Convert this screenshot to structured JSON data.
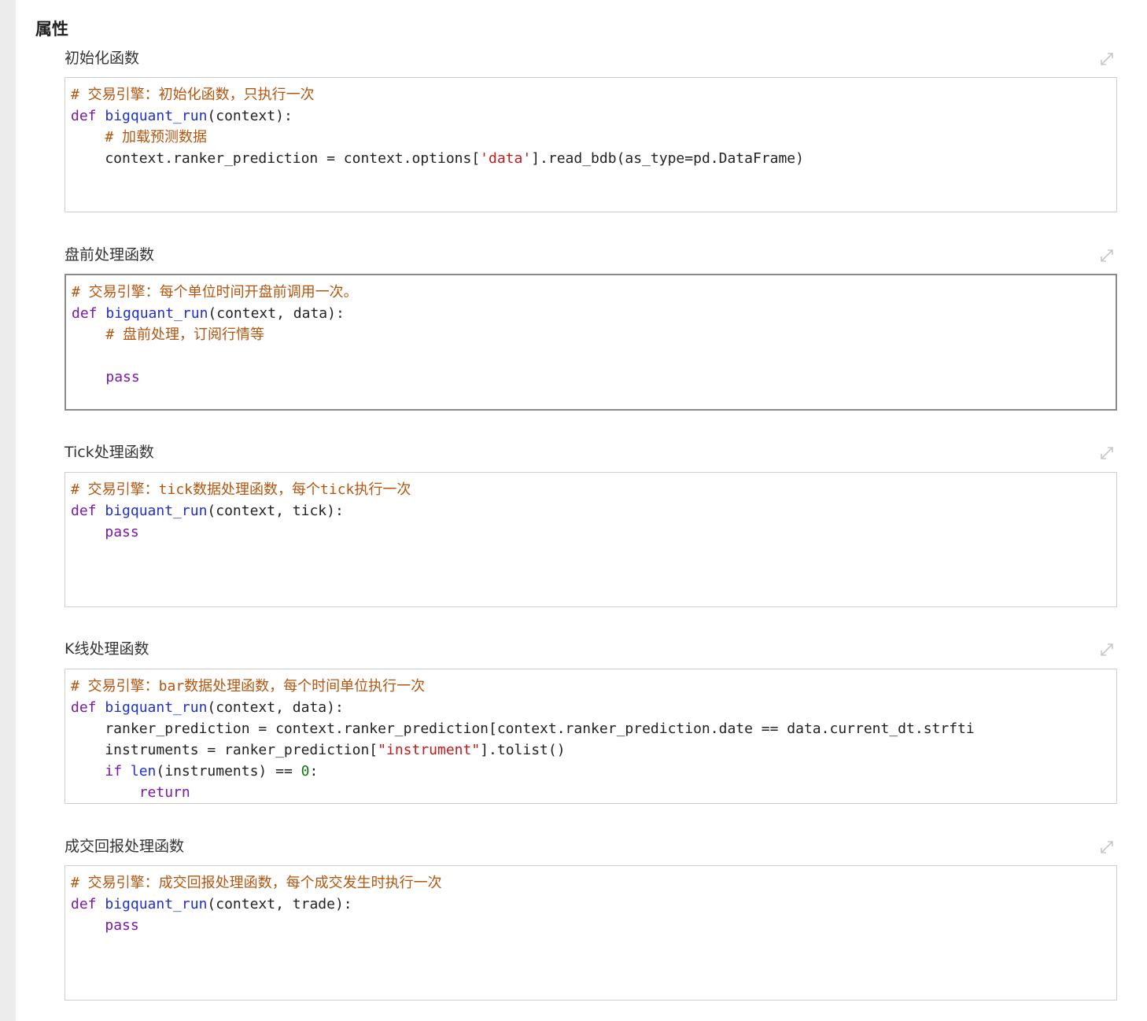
{
  "section_title": "属性",
  "properties": [
    {
      "label": "初始化函数",
      "lines": [
        [
          {
            "t": "cm",
            "s": "# 交易引擎：初始化函数，只执行一次"
          }
        ],
        [
          {
            "t": "kw",
            "s": "def "
          },
          {
            "t": "fn",
            "s": "bigquant_run"
          },
          {
            "t": "",
            "s": "(context):"
          }
        ],
        [
          {
            "t": "",
            "s": "    "
          },
          {
            "t": "cm",
            "s": "# 加载预测数据"
          }
        ],
        [
          {
            "t": "",
            "s": "    context.ranker_prediction = context.options["
          },
          {
            "t": "st",
            "s": "'data'"
          },
          {
            "t": "",
            "s": "].read_bdb(as_type=pd.DataFrame)"
          }
        ]
      ]
    },
    {
      "label": "盘前处理函数",
      "lines": [
        [
          {
            "t": "cm",
            "s": "# 交易引擎：每个单位时间开盘前调用一次。"
          }
        ],
        [
          {
            "t": "kw",
            "s": "def "
          },
          {
            "t": "fn",
            "s": "bigquant_run"
          },
          {
            "t": "",
            "s": "(context, data):"
          }
        ],
        [
          {
            "t": "",
            "s": "    "
          },
          {
            "t": "cm",
            "s": "# 盘前处理，订阅行情等"
          }
        ],
        [
          {
            "t": "",
            "s": ""
          }
        ],
        [
          {
            "t": "",
            "s": "    "
          },
          {
            "t": "kw",
            "s": "pass"
          }
        ]
      ]
    },
    {
      "label": "Tick处理函数",
      "lines": [
        [
          {
            "t": "cm",
            "s": "# 交易引擎：tick数据处理函数，每个tick执行一次"
          }
        ],
        [
          {
            "t": "kw",
            "s": "def "
          },
          {
            "t": "fn",
            "s": "bigquant_run"
          },
          {
            "t": "",
            "s": "(context, tick):"
          }
        ],
        [
          {
            "t": "",
            "s": "    "
          },
          {
            "t": "kw",
            "s": "pass"
          }
        ]
      ]
    },
    {
      "label": "K线处理函数",
      "lines": [
        [
          {
            "t": "cm",
            "s": "# 交易引擎：bar数据处理函数，每个时间单位执行一次"
          }
        ],
        [
          {
            "t": "kw",
            "s": "def "
          },
          {
            "t": "fn",
            "s": "bigquant_run"
          },
          {
            "t": "",
            "s": "(context, data):"
          }
        ],
        [
          {
            "t": "",
            "s": "    ranker_prediction = context.ranker_prediction[context.ranker_prediction.date == data.current_dt.strfti"
          }
        ],
        [
          {
            "t": "",
            "s": "    instruments = ranker_prediction["
          },
          {
            "t": "st",
            "s": "\"instrument\""
          },
          {
            "t": "",
            "s": "].tolist()"
          }
        ],
        [
          {
            "t": "",
            "s": "    "
          },
          {
            "t": "kw",
            "s": "if "
          },
          {
            "t": "fn",
            "s": "len"
          },
          {
            "t": "",
            "s": "(instruments) == "
          },
          {
            "t": "nm",
            "s": "0"
          },
          {
            "t": "",
            "s": ":"
          }
        ],
        [
          {
            "t": "",
            "s": "        "
          },
          {
            "t": "kw",
            "s": "return"
          }
        ]
      ]
    },
    {
      "label": "成交回报处理函数",
      "lines": [
        [
          {
            "t": "cm",
            "s": "# 交易引擎：成交回报处理函数，每个成交发生时执行一次"
          }
        ],
        [
          {
            "t": "kw",
            "s": "def "
          },
          {
            "t": "fn",
            "s": "bigquant_run"
          },
          {
            "t": "",
            "s": "(context, trade):"
          }
        ],
        [
          {
            "t": "",
            "s": "    "
          },
          {
            "t": "kw",
            "s": "pass"
          }
        ]
      ]
    }
  ]
}
